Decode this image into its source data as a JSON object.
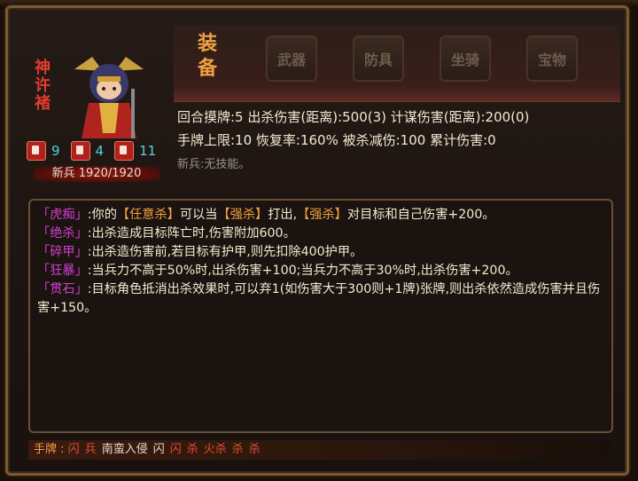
{
  "hero": {
    "name": "神许褚",
    "stats": [
      {
        "icon": "card-icon",
        "value": "9"
      },
      {
        "icon": "sword-icon",
        "value": "4"
      },
      {
        "icon": "horse-icon",
        "value": "11"
      }
    ],
    "soldier": "新兵 1920/1920"
  },
  "equipment": {
    "title": "装备",
    "slots": [
      "武器",
      "防具",
      "坐骑",
      "宝物"
    ]
  },
  "info": {
    "line1": "回合摸牌:5   出杀伤害(距离):500(3)   计谋伤害(距离):200(0)",
    "line2": "手牌上限:10   恢复率:160%   被杀减伤:100   累计伤害:0",
    "line3": "新兵:无技能。"
  },
  "skills": [
    {
      "name": "「虎痴」",
      "parts": [
        ":你的",
        "【任意杀】",
        "可以当",
        "【强杀】",
        "打出,",
        "【强杀】",
        "对目标和自己伤害+200。"
      ]
    },
    {
      "name": "「绝杀」",
      "text": ":出杀造成目标阵亡时,伤害附加600。"
    },
    {
      "name": "「碎甲」",
      "text": ":出杀造伤害前,若目标有护甲,则先扣除400护甲。"
    },
    {
      "name": "「狂暴」",
      "text": ":当兵力不高于50%时,出杀伤害+100;当兵力不高于30%时,出杀伤害+200。"
    },
    {
      "name": "「贯石」",
      "text": ":目标角色抵消出杀效果时,可以弃1(如伤害大于300则+1牌)张牌,则出杀依然造成伤害并且伤害+150。"
    }
  ],
  "hand": {
    "label": "手牌 : ",
    "cards": [
      {
        "text": "闪",
        "color": "red"
      },
      {
        "text": "兵",
        "color": "red"
      },
      {
        "text": "南蛮入侵",
        "color": "white"
      },
      {
        "text": "闪",
        "color": "white"
      },
      {
        "text": "闪",
        "color": "red"
      },
      {
        "text": "杀",
        "color": "red"
      },
      {
        "text": "火杀",
        "color": "red"
      },
      {
        "text": "杀",
        "color": "red"
      },
      {
        "text": "杀",
        "color": "red"
      }
    ]
  },
  "colors": {
    "skill_name": "#d040d0",
    "highlight": "#f0a040",
    "cyan_num": "#4fd4e0"
  }
}
